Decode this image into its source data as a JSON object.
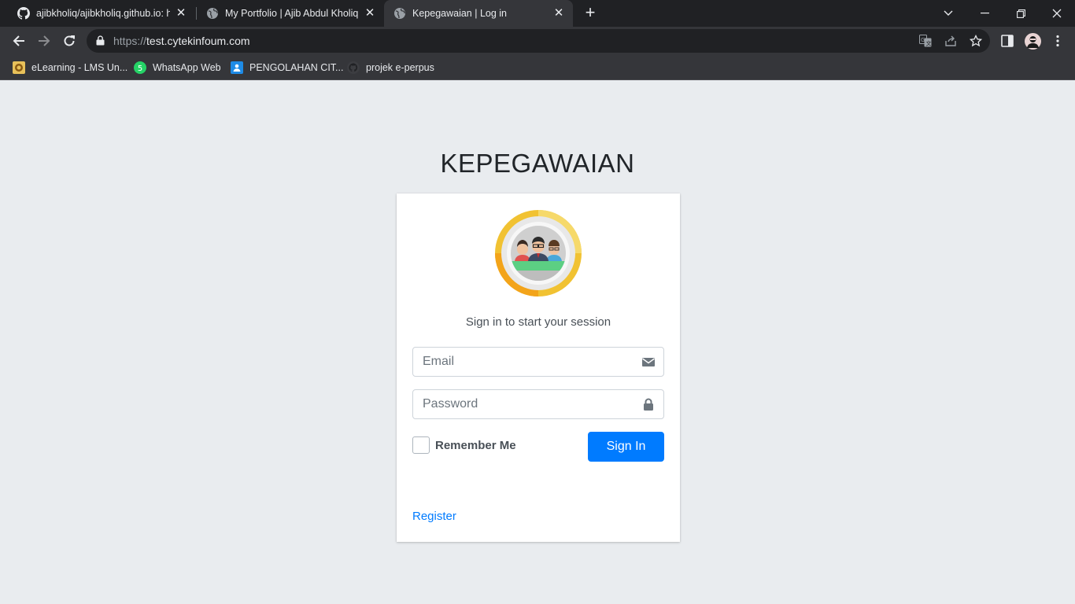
{
  "browser": {
    "tabs": [
      {
        "title": "ajibkholiq/ajibkholiq.github.io: ha",
        "favicon": "github-icon",
        "active": false
      },
      {
        "title": "My Portfolio | Ajib Abdul Kholiq",
        "favicon": "globe-icon",
        "active": false
      },
      {
        "title": "Kepegawaian | Log in",
        "favicon": "globe-icon",
        "active": true
      }
    ],
    "address": {
      "scheme": "https://",
      "host": "test.cytekinfoum.com"
    },
    "bookmarks": [
      {
        "label": "eLearning - LMS Un...",
        "icon": "university-seal-icon"
      },
      {
        "label": "WhatsApp Web",
        "icon": "whatsapp-icon",
        "badge": "5"
      },
      {
        "label": "PENGOLAHAN CIT...",
        "icon": "classroom-icon"
      },
      {
        "label": "projek e-perpus",
        "icon": "github-icon"
      }
    ]
  },
  "login": {
    "brand": "KEPEGAWAIAN",
    "logo": "team-avatar-logo",
    "message": "Sign in to start your session",
    "email_placeholder": "Email",
    "password_placeholder": "Password",
    "remember_label": "Remember Me",
    "signin_label": "Sign In",
    "register_label": "Register"
  },
  "colors": {
    "page_bg": "#e9ecef",
    "primary": "#007bff",
    "chrome_dark": "#202124",
    "chrome_toolbar": "#35363a"
  }
}
